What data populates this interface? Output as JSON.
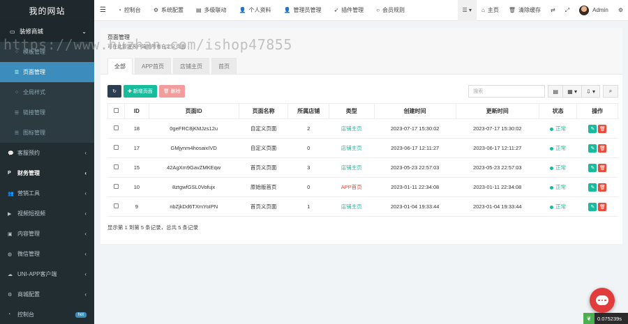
{
  "brand": "我的网站",
  "sidebar": {
    "group": {
      "label": "装修商城",
      "icon": "monitor-icon"
    },
    "sub_items": [
      {
        "label": "模板管理",
        "icon": "circle-icon",
        "active": false
      },
      {
        "label": "页面管理",
        "icon": "list-icon",
        "active": true
      },
      {
        "label": "全局样式",
        "icon": "circle-icon",
        "active": false
      },
      {
        "label": "链接管理",
        "icon": "list-icon",
        "active": false
      },
      {
        "label": "图标管理",
        "icon": "list-icon",
        "active": false
      }
    ],
    "items": [
      {
        "label": "客服预约",
        "icon": "chat-icon"
      },
      {
        "label": "财务管理",
        "icon": "paypal-icon"
      },
      {
        "label": "营销工具",
        "icon": "users-icon"
      },
      {
        "label": "视频短视频",
        "icon": "video-icon"
      },
      {
        "label": "内容管理",
        "icon": "inbox-icon"
      },
      {
        "label": "微信管理",
        "icon": "wechat-icon"
      },
      {
        "label": "UNI-APP客户端",
        "icon": "cloud-icon"
      },
      {
        "label": "商城配置",
        "icon": "gear-icon"
      },
      {
        "label": "控制台",
        "icon": "dashboard-icon",
        "badge": "hot"
      }
    ]
  },
  "topbar": {
    "nav": [
      {
        "label": "控制台",
        "icon": "dashboard-icon"
      },
      {
        "label": "系统配置",
        "icon": "gear-icon"
      },
      {
        "label": "多级联动",
        "icon": "list-icon"
      },
      {
        "label": "个人资料",
        "icon": "user-icon"
      },
      {
        "label": "管理员管理",
        "icon": "user-icon"
      },
      {
        "label": "插件管理",
        "icon": "rocket-icon"
      },
      {
        "label": "会员规则",
        "icon": "circle-icon"
      }
    ],
    "home": "主页",
    "clear_cache": "清除缓存",
    "admin": "Admin"
  },
  "watermark": "https://www.huzhan.com/ishop47855",
  "panel": {
    "title": "页面管理",
    "description": "可在此管理客户端的所有自定义页面",
    "tabs": [
      "全部",
      "APP首页",
      "店铺主页",
      "首页"
    ],
    "add_label": "新增页面",
    "delete_label": "删除",
    "search_placeholder": "搜索"
  },
  "table": {
    "headers": [
      "ID",
      "页面ID",
      "页面名称",
      "所属店铺",
      "类型",
      "创建时间",
      "更新时间",
      "状态",
      "操作"
    ],
    "rows": [
      {
        "id": "18",
        "page_id": "0geFRC8jKMJzs12u",
        "name": "自定义页面",
        "shop": "2",
        "type": "店铺主页",
        "type_color": "green",
        "created": "2023-07-17 15:30:02",
        "updated": "2023-07-17 15:30:02",
        "status": "正常"
      },
      {
        "id": "17",
        "page_id": "GMjynm4hosaixIVD",
        "name": "自定义页面",
        "shop": "0",
        "type": "店铺主页",
        "type_color": "green",
        "created": "2023-06-17 12:11:27",
        "updated": "2023-06-17 12:11:27",
        "status": "正常"
      },
      {
        "id": "15",
        "page_id": "42AgXm9GavZMKEqw",
        "name": "首页义页面",
        "shop": "3",
        "type": "店铺主页",
        "type_color": "green",
        "created": "2023-05-23 22:57:03",
        "updated": "2023-05-23 22:57:03",
        "status": "正常"
      },
      {
        "id": "10",
        "page_id": "8ztgwfGSL0Vofujx",
        "name": "原始版首页",
        "shop": "0",
        "type": "APP首页",
        "type_color": "red",
        "created": "2023-01-11 22:34:08",
        "updated": "2023-01-11 22:34:08",
        "status": "正常"
      },
      {
        "id": "9",
        "page_id": "nbZjkDd6TXmYoIPN",
        "name": "首页义页面",
        "shop": "1",
        "type": "店铺主页",
        "type_color": "green",
        "created": "2023-01-04 19:33:44",
        "updated": "2023-01-04 19:33:44",
        "status": "正常"
      }
    ],
    "footer": "显示第 1 到第 5 条记录，总共 5 条记录"
  },
  "timer": "0.075239s",
  "colors": {
    "sidebar_bg": "#222d32",
    "active": "#3c8dbc",
    "green": "#18bc9c",
    "red": "#e74c3c"
  }
}
